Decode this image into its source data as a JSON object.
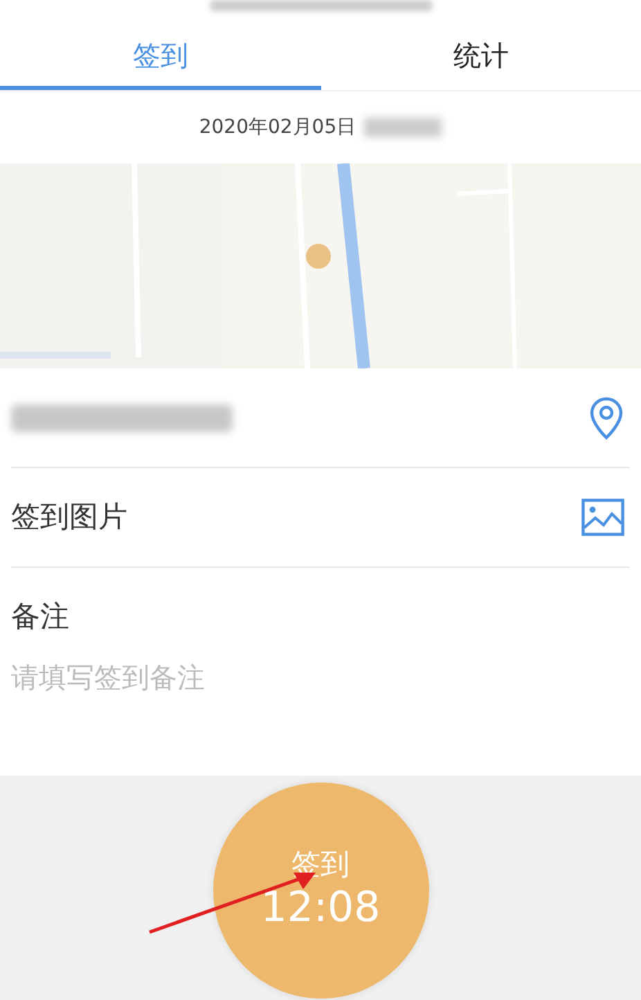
{
  "tabs": [
    {
      "label": "签到",
      "selected": true
    },
    {
      "label": "统计",
      "selected": false
    }
  ],
  "date": "2020年02月05日",
  "rows": [
    {
      "kind": "location"
    },
    {
      "label": "签到图片"
    }
  ],
  "note": {
    "label": "备注",
    "placeholder": "请填写签到备注"
  },
  "checkin_button": {
    "label": "签到",
    "time": "12:08"
  }
}
